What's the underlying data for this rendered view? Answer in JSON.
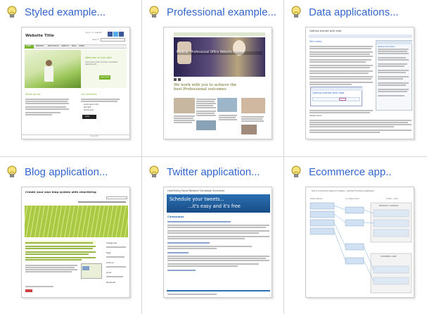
{
  "tiles": [
    {
      "title": "Styled example...",
      "thumb": {
        "site_title": "Website Title",
        "login": "Log in or register",
        "search": "Search",
        "nav": [
          "HOME",
          "SERVICES",
          "WHAT WE DO",
          "CONTACT",
          "BLOG",
          "ADMIN"
        ],
        "welcome": "Welcome to this site!",
        "hero_text": "Lorem ipsum dolor sit amet, consectetur adipiscing elit.",
        "hero_button": "READ MORE",
        "col1_title": "What we do",
        "col2_title": "Our services",
        "list": [
          "Lorem ipsum dolor",
          "Sed diam",
          "Ut wisi enim"
        ],
        "button2": "MORE",
        "footer": "Copyright"
      }
    },
    {
      "title": "Professional example...",
      "thumb": {
        "banner_text": "Medical · Professional Office Website created",
        "headline": "We work with you to achieve the best Professional outcomes"
      }
    },
    {
      "title": "Data applications...",
      "thumb": {
        "heading": "Getting started with data",
        "section": "Tech notes",
        "sidebar_title": "Related information",
        "dialog_title": "Getting started with data",
        "footer_title": "Related items"
      }
    },
    {
      "title": "Blog application...",
      "thumb": {
        "heading": "Create your own blog system with clearString",
        "sidebar": [
          "Categories",
          "Tags",
          "Archive",
          "Links",
          "Facebook"
        ]
      }
    },
    {
      "title": "Twitter application...",
      "thumb": {
        "top": "clearString Social Network Campaign Scheduler",
        "banner_line1": "Schedule your tweets...",
        "banner_line2": "...it's easy and it's free",
        "section": "Campaigns"
      }
    },
    {
      "title": "Ecommerce app..",
      "thumb": {
        "heading": "How to connect the objects for Catalog - customer Ecommerce application",
        "cols": [
          "Data tables",
          "Configuration",
          "Public view"
        ],
        "catalog": "PRODUCT CATALOG",
        "cart": "SHOPPING CART"
      }
    }
  ],
  "colors": {
    "link": "#3366cc",
    "bulb": "#f3d64c",
    "border": "#d6d6d6",
    "green": "#78b52b"
  },
  "icons": {
    "tile_icon": "lightbulb-icon"
  }
}
